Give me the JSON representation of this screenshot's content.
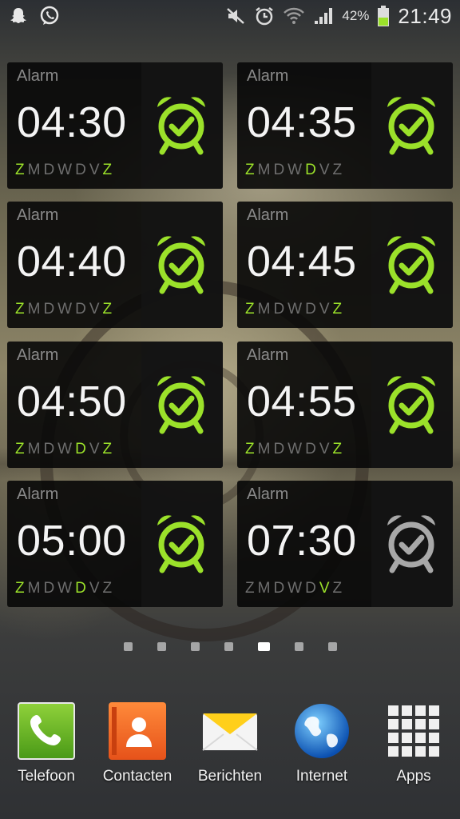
{
  "status_bar": {
    "left_icons": [
      "snapchat-icon",
      "whatsapp-icon"
    ],
    "right_icons": [
      "mute-icon",
      "alarm-status-icon",
      "wifi-icon",
      "signal-icon",
      "battery-icon"
    ],
    "battery_percent": "42%",
    "time": "21:49"
  },
  "colors": {
    "active_green": "#9be12a",
    "inactive_grey": "#6e6e6e"
  },
  "alarms": [
    {
      "label": "Alarm",
      "time": "04:30",
      "days": [
        "Z",
        "M",
        "D",
        "W",
        "D",
        "V",
        "Z"
      ],
      "active_days": [
        true,
        false,
        false,
        false,
        false,
        false,
        true
      ],
      "enabled": true
    },
    {
      "label": "Alarm",
      "time": "04:35",
      "days": [
        "Z",
        "M",
        "D",
        "W",
        "D",
        "V",
        "Z"
      ],
      "active_days": [
        true,
        false,
        false,
        false,
        true,
        false,
        false
      ],
      "enabled": true
    },
    {
      "label": "Alarm",
      "time": "04:40",
      "days": [
        "Z",
        "M",
        "D",
        "W",
        "D",
        "V",
        "Z"
      ],
      "active_days": [
        true,
        false,
        false,
        false,
        false,
        false,
        true
      ],
      "enabled": true
    },
    {
      "label": "Alarm",
      "time": "04:45",
      "days": [
        "Z",
        "M",
        "D",
        "W",
        "D",
        "V",
        "Z"
      ],
      "active_days": [
        true,
        false,
        false,
        false,
        false,
        false,
        true
      ],
      "enabled": true
    },
    {
      "label": "Alarm",
      "time": "04:50",
      "days": [
        "Z",
        "M",
        "D",
        "W",
        "D",
        "V",
        "Z"
      ],
      "active_days": [
        true,
        false,
        false,
        false,
        true,
        false,
        true
      ],
      "enabled": true
    },
    {
      "label": "Alarm",
      "time": "04:55",
      "days": [
        "Z",
        "M",
        "D",
        "W",
        "D",
        "V",
        "Z"
      ],
      "active_days": [
        true,
        false,
        false,
        false,
        false,
        false,
        true
      ],
      "enabled": true
    },
    {
      "label": "Alarm",
      "time": "05:00",
      "days": [
        "Z",
        "M",
        "D",
        "W",
        "D",
        "V",
        "Z"
      ],
      "active_days": [
        true,
        false,
        false,
        false,
        true,
        false,
        false
      ],
      "enabled": true
    },
    {
      "label": "Alarm",
      "time": "07:30",
      "days": [
        "Z",
        "M",
        "D",
        "W",
        "D",
        "V",
        "Z"
      ],
      "active_days": [
        false,
        false,
        false,
        false,
        false,
        true,
        false
      ],
      "enabled": false
    }
  ],
  "pager": {
    "count": 7,
    "active_index": 4
  },
  "dock": [
    {
      "label": "Telefoon",
      "icon": "phone-icon"
    },
    {
      "label": "Contacten",
      "icon": "contacts-icon"
    },
    {
      "label": "Berichten",
      "icon": "messages-icon"
    },
    {
      "label": "Internet",
      "icon": "globe-icon"
    },
    {
      "label": "Apps",
      "icon": "apps-grid-icon"
    }
  ]
}
